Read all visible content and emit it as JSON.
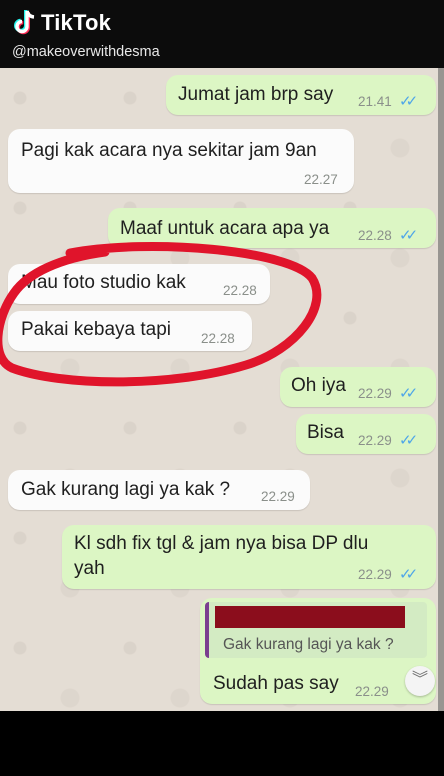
{
  "app": {
    "name": "TikTok",
    "handle": "@makeoverwithdesma"
  },
  "colors": {
    "outgoing": "#dcf6c4",
    "incoming": "#fbfbfb",
    "read_ticks": "#4fa6e8",
    "annotation": "#e0142b"
  },
  "messages": [
    {
      "dir": "out",
      "text": "Jumat jam brp say",
      "time": "21.41",
      "ticks": "✓✓"
    },
    {
      "dir": "in",
      "text": "Pagi kak acara nya sekitar jam 9an",
      "time": "22.27"
    },
    {
      "dir": "out",
      "text": "Maaf untuk acara apa ya",
      "time": "22.28",
      "ticks": "✓✓"
    },
    {
      "dir": "in",
      "text": "Mau foto studio kak",
      "time": "22.28"
    },
    {
      "dir": "in",
      "text": "Pakai kebaya tapi",
      "time": "22.28"
    },
    {
      "dir": "out",
      "text": "Oh iya",
      "time": "22.29",
      "ticks": "✓✓"
    },
    {
      "dir": "out",
      "text": "Bisa",
      "time": "22.29",
      "ticks": "✓✓"
    },
    {
      "dir": "in",
      "text": "Gak kurang lagi ya kak ?",
      "time": "22.29"
    },
    {
      "dir": "out",
      "text_line1": "Kl sdh fix tgl & jam nya bisa DP dlu",
      "text_line2": "yah",
      "time": "22.29",
      "ticks": "✓✓"
    },
    {
      "dir": "out",
      "quote": "Gak kurang lagi ya kak ?",
      "text": "Sudah pas say",
      "time": "22.29"
    }
  ],
  "scroll_down_icon": "chevron-double-down-icon"
}
